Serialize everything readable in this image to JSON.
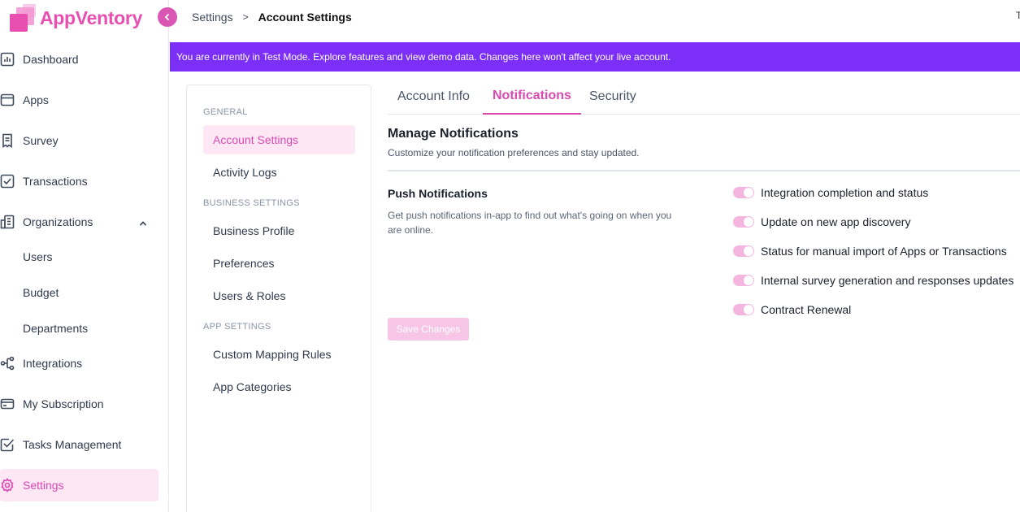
{
  "app": {
    "name": "AppVentory"
  },
  "colors": {
    "accent": "#d94ab0",
    "banner": "#7b2ff7",
    "active_bg": "#fde7f5"
  },
  "sidebar": {
    "items": [
      {
        "label": "Dashboard",
        "icon": "bar-chart-icon"
      },
      {
        "label": "Apps",
        "icon": "window-icon"
      },
      {
        "label": "Survey",
        "icon": "document-icon"
      },
      {
        "label": "Transactions",
        "icon": "checkbox-icon"
      },
      {
        "label": "Organizations",
        "icon": "building-icon",
        "expanded": true
      },
      {
        "label": "Users",
        "sub": true
      },
      {
        "label": "Budget",
        "sub": true
      },
      {
        "label": "Departments",
        "sub": true
      },
      {
        "label": "Integrations",
        "icon": "integration-icon"
      },
      {
        "label": "My Subscription",
        "icon": "credit-card-icon"
      },
      {
        "label": "Tasks Management",
        "icon": "task-icon"
      },
      {
        "label": "Settings",
        "icon": "gear-icon",
        "active": true
      }
    ]
  },
  "header": {
    "breadcrumb": [
      "Settings",
      "Account Settings"
    ],
    "separator": ">",
    "edge_text": "T"
  },
  "banner": {
    "text": "You are currently in Test Mode. Explore features and view demo data. Changes here won't affect your live account."
  },
  "settings_nav": {
    "sections": [
      {
        "title": "GENERAL",
        "items": [
          "Account Settings",
          "Activity Logs"
        ]
      },
      {
        "title": "BUSINESS SETTINGS",
        "items": [
          "Business Profile",
          "Preferences",
          "Users & Roles"
        ]
      },
      {
        "title": "APP SETTINGS",
        "items": [
          "Custom Mapping Rules",
          "App Categories"
        ]
      }
    ],
    "active": "Account Settings"
  },
  "tabs": [
    {
      "label": "Account Info"
    },
    {
      "label": "Notifications",
      "active": true
    },
    {
      "label": "Security"
    }
  ],
  "notifications": {
    "title": "Manage Notifications",
    "subtitle": "Customize your notification preferences and stay updated.",
    "push_title": "Push Notifications",
    "push_desc": "Get push notifications in-app to find out what's going on when you are online.",
    "toggles": [
      {
        "label": "Integration completion and status",
        "on": true
      },
      {
        "label": "Update on new app discovery",
        "on": true
      },
      {
        "label": "Status for manual import of Apps or Transactions",
        "on": true
      },
      {
        "label": "Internal survey generation and responses updates",
        "on": true
      },
      {
        "label": "Contract Renewal",
        "on": true
      }
    ],
    "save_label": "Save Changes"
  }
}
